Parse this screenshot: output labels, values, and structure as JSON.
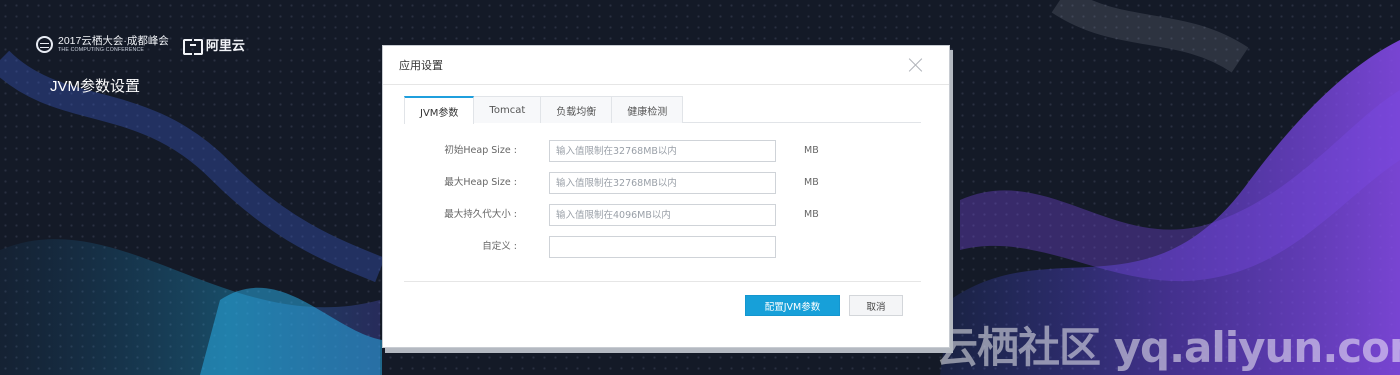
{
  "slide": {
    "conference_main": "2017云栖大会·成都峰会",
    "conference_sub": "THE COMPUTING CONFERENCE",
    "aliyun_text": "阿里云",
    "title": "JVM参数设置",
    "watermark": "云栖社区 yq.aliyun.com"
  },
  "dialog": {
    "title": "应用设置",
    "tabs": [
      {
        "label": "JVM参数",
        "active": true
      },
      {
        "label": "Tomcat",
        "active": false
      },
      {
        "label": "负载均衡",
        "active": false
      },
      {
        "label": "健康检测",
        "active": false
      }
    ],
    "fields": [
      {
        "label": "初始Heap Size :",
        "placeholder": "输入值限制在32768MB以内",
        "value": "",
        "unit": "MB"
      },
      {
        "label": "最大Heap Size :",
        "placeholder": "输入值限制在32768MB以内",
        "value": "",
        "unit": "MB"
      },
      {
        "label": "最大持久代大小 :",
        "placeholder": "输入值限制在4096MB以内",
        "value": "",
        "unit": "MB"
      },
      {
        "label": "自定义 :",
        "placeholder": "",
        "value": "",
        "unit": ""
      }
    ],
    "primary_button": "配置JVM参数",
    "cancel_button": "取消"
  },
  "colors": {
    "background": "#141a27",
    "accent": "#17a0d9",
    "wave_purple": "#6a43e0",
    "wave_cyan": "#22b8f0"
  }
}
